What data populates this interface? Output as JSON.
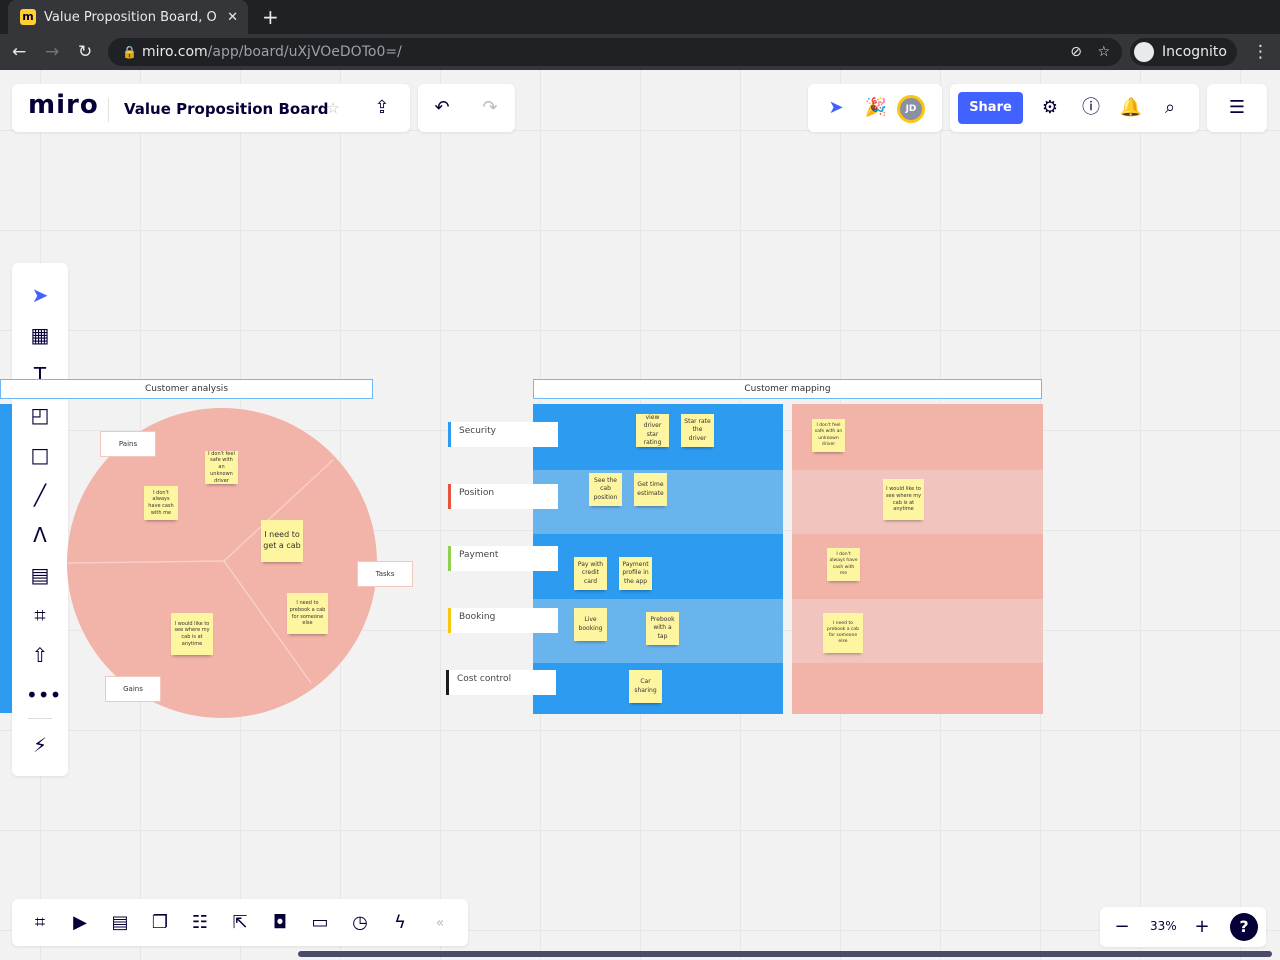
{
  "browser": {
    "tab_title": "Value Proposition Board, O",
    "url_host": "miro.com",
    "url_path": "/app/board/uXjVOeDOTo0=/",
    "incognito_label": "Incognito"
  },
  "header": {
    "logo": "miro",
    "board_title": "Value Proposition Board",
    "share_label": "Share",
    "avatar_initials": "JD"
  },
  "colors": {
    "accent": "#4262ff",
    "blue_row": "#2d9bf0",
    "blue_row_light": "#6ab4ee",
    "pink_row": "#f2b3a8",
    "pink_row_light": "#f1c4bd",
    "sticky": "#fef5a0"
  },
  "customer_analysis": {
    "title": "Customer analysis",
    "tags": {
      "pains": "Pains",
      "tasks": "Tasks",
      "gains": "Gains"
    },
    "stickies": [
      "I don't feel safe with an unknown driver",
      "I don't always have cash with me",
      "I need to get a cab",
      "I need to prebook a cab for someone else",
      "I would like to see where my cab is at anytime"
    ]
  },
  "customer_mapping": {
    "title": "Customer mapping",
    "rows": [
      {
        "label": "Security"
      },
      {
        "label": "Position"
      },
      {
        "label": "Payment"
      },
      {
        "label": "Booking"
      },
      {
        "label": "Cost control"
      }
    ],
    "blue_stickies": [
      "view driver star rating",
      "Star rate the driver",
      "See the cab position",
      "Get time estimate",
      "Pay with credit card",
      "Payment profile in the app",
      "Live booking",
      "Prebook with a tap",
      "Car sharing"
    ],
    "pink_stickies": [
      "I don't feel safe with an unknown driver",
      "I would like to see where my cab is at anytime",
      "I don't always have cash with me",
      "I need to prebook a cab for someone else"
    ]
  },
  "zoom": {
    "level": "33%",
    "help": "?"
  }
}
